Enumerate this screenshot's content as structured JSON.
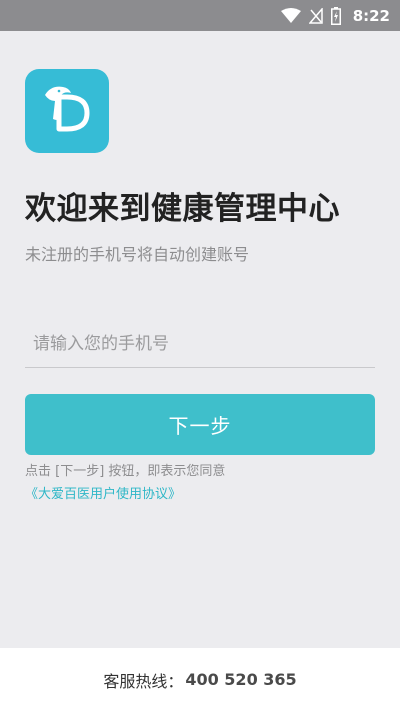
{
  "status_bar": {
    "time": "8:22",
    "icons": [
      "wifi-icon",
      "signal-icon",
      "battery-charging-icon"
    ]
  },
  "colors": {
    "accent": "#3fbfcb",
    "logo_bg": "#36bcd6",
    "link": "#2fb7c7",
    "status_bar_bg": "#8c8c8f"
  },
  "logo": {
    "icon": "dolphin-logo-icon"
  },
  "title": "欢迎来到健康管理中心",
  "subtitle": "未注册的手机号将自动创建账号",
  "phone_input": {
    "value": "",
    "placeholder": "请输入您的手机号"
  },
  "next_button": {
    "label": "下一步"
  },
  "agreement": {
    "prefix": "点击 [下一步] 按钮，即表示您同意",
    "link_text": "《大爱百医用户使用协议》"
  },
  "footer": {
    "hotline_label": "客服热线：",
    "hotline_number": "400 520 365"
  }
}
